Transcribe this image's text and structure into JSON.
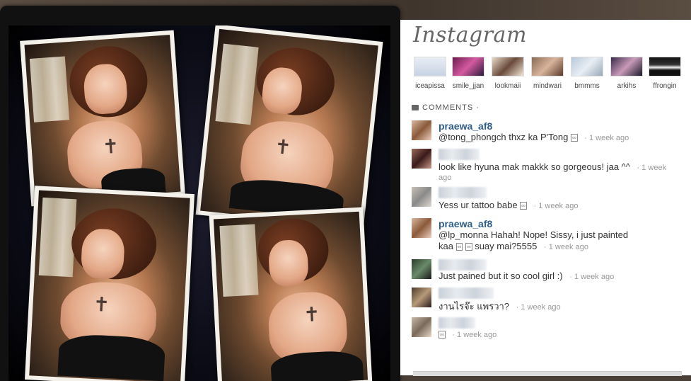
{
  "app": {
    "logo": "Instagram",
    "brand_color": "#2f5e88"
  },
  "likers": [
    {
      "name": "iceapissa"
    },
    {
      "name": "smile_jjan"
    },
    {
      "name": "lookmaii"
    },
    {
      "name": "mindwari"
    },
    {
      "name": "bmmms"
    },
    {
      "name": "arkihs"
    },
    {
      "name": "ffrongin"
    }
  ],
  "comments_header": "COMMENTS ·",
  "comments": [
    {
      "user": "praewa_af8",
      "text": "@tong_phongch thxz ka P'Tong",
      "time": "· 1 week ago"
    },
    {
      "user": "",
      "text": "look like hyuna mak makkk so gorgeous! jaa ^^",
      "time": "· 1 week",
      "time2": "ago"
    },
    {
      "user": "",
      "text": "Yess ur tattoo babe",
      "time": "· 1 week ago"
    },
    {
      "user": "praewa_af8",
      "text": "@lp_monna Hahah! Nope! Sissy, i just painted",
      "text2": "kaa",
      "text3": "suay mai?5555",
      "time": "· 1 week ago"
    },
    {
      "user": "",
      "text": "Just pained but it so cool girl :)",
      "time": "· 1 week ago"
    },
    {
      "user": "",
      "text": "งานไรจ๊ะ แพรวา?",
      "time": "· 1 week ago"
    },
    {
      "user": "",
      "text": "",
      "time": "· 1 week ago"
    }
  ]
}
